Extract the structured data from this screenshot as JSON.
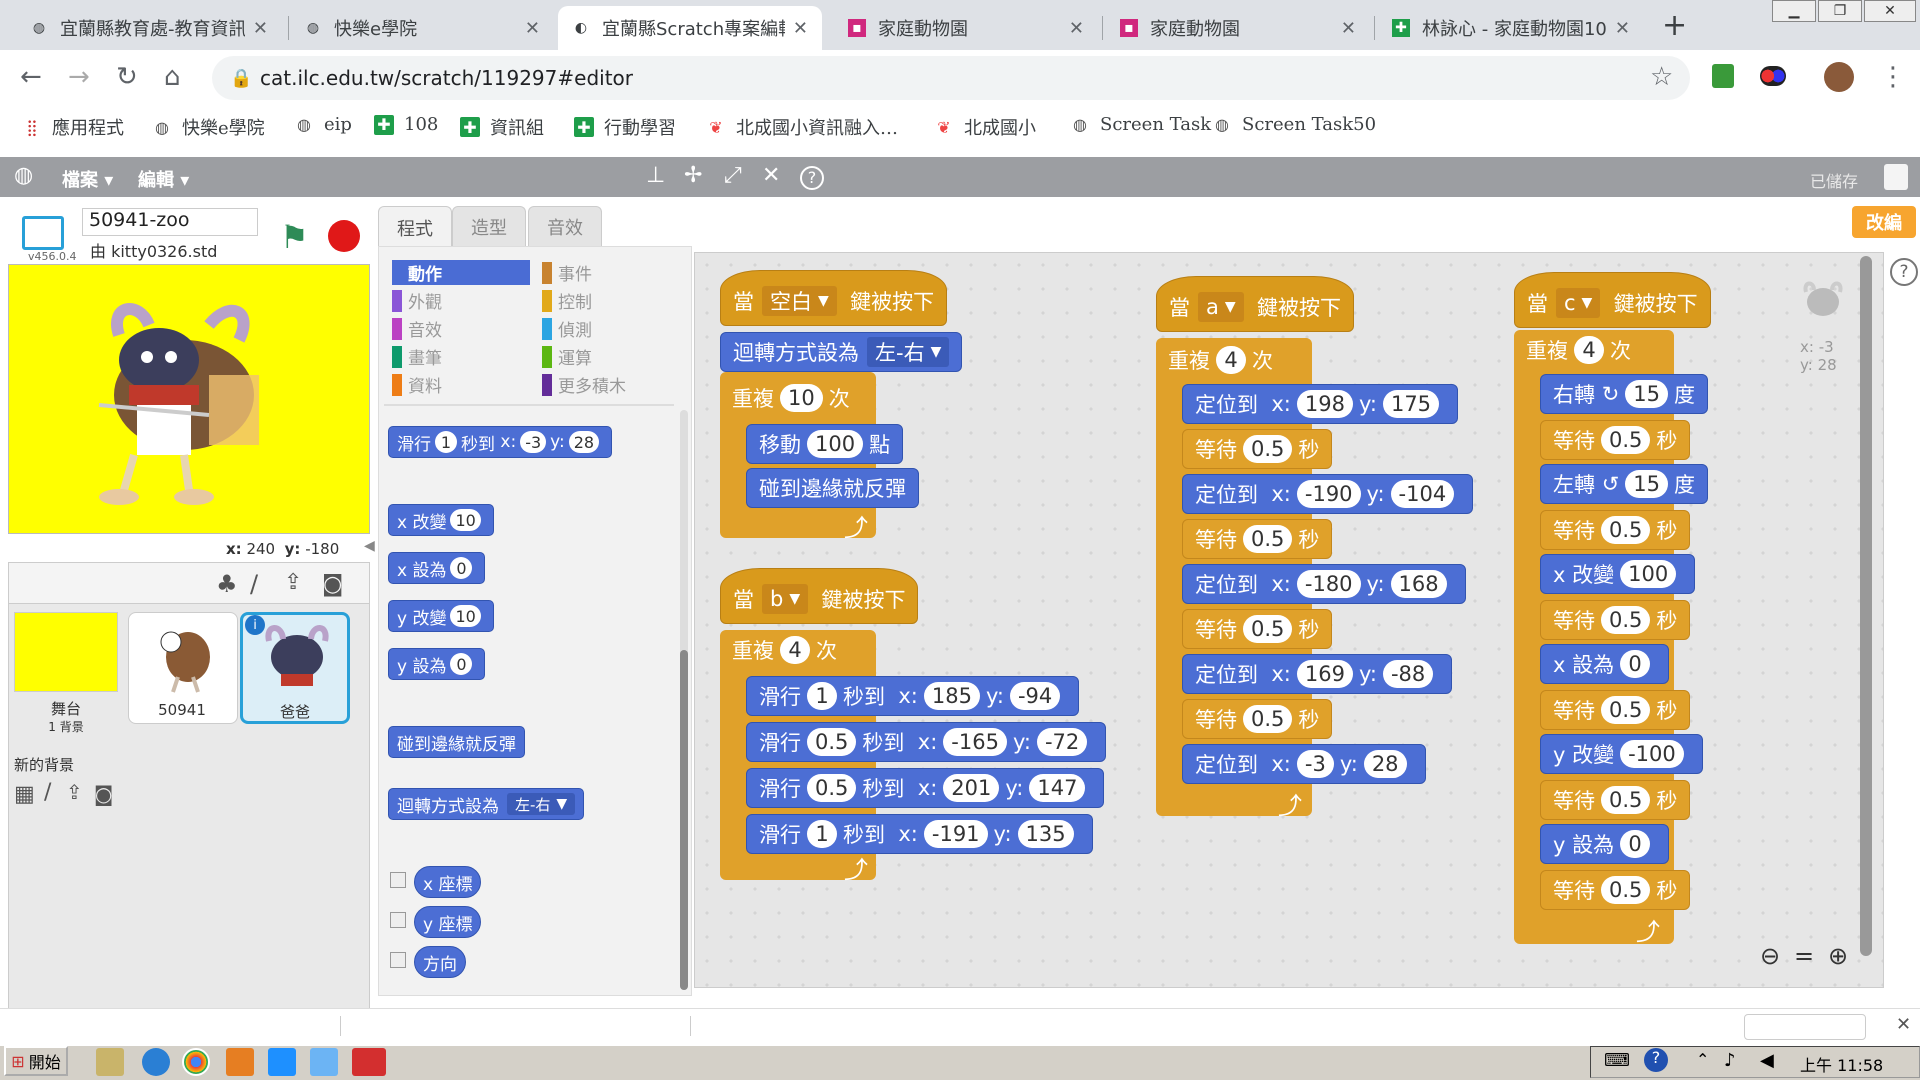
{
  "browser": {
    "tabs": [
      {
        "title": "宜蘭縣教育處-教育資訊",
        "active": false
      },
      {
        "title": "快樂e學院",
        "active": false
      },
      {
        "title": "宜蘭縣Scratch專案編輯",
        "active": true
      },
      {
        "title": "家庭動物園",
        "active": false
      },
      {
        "title": "家庭動物園",
        "active": false
      },
      {
        "title": "林詠心 - 家庭動物園10",
        "active": false
      }
    ],
    "url": "cat.ilc.edu.tw/scratch/119297#editor",
    "bookmarks": [
      "應用程式",
      "快樂e學院",
      "eip",
      "108",
      "資訊組",
      "行動學習",
      "北成國小資訊融入…",
      "北成國小",
      "Screen Task",
      "Screen Task50"
    ]
  },
  "scratch": {
    "menu": {
      "file": "檔案",
      "edit": "編輯",
      "saved": "已儲存",
      "edit_button": "改編"
    },
    "project": {
      "name": "50941-zoo",
      "author": "由 kitty0326.std",
      "version": "v456.0.4"
    },
    "stage_coords": {
      "x_label": "x:",
      "x": "240",
      "y_label": "y:",
      "y": "-180"
    },
    "stage_card": {
      "label": "舞台",
      "sub": "1 背景",
      "new_bg": "新的背景"
    },
    "sprites": [
      {
        "name": "50941",
        "selected": false
      },
      {
        "name": "爸爸",
        "selected": true
      }
    ],
    "tabs": [
      "程式",
      "造型",
      "音效"
    ],
    "categories": {
      "left": [
        {
          "label": "動作",
          "color": "#4a6cd4",
          "active": true
        },
        {
          "label": "外觀",
          "color": "#8a55d7"
        },
        {
          "label": "音效",
          "color": "#bb42c3"
        },
        {
          "label": "畫筆",
          "color": "#0e9a6c"
        },
        {
          "label": "資料",
          "color": "#ee7d16"
        }
      ],
      "right": [
        {
          "label": "事件",
          "color": "#c88330"
        },
        {
          "label": "控制",
          "color": "#e1a91a"
        },
        {
          "label": "偵測",
          "color": "#2ca5e2"
        },
        {
          "label": "運算",
          "color": "#5cb712"
        },
        {
          "label": "更多積木",
          "color": "#632d99"
        }
      ]
    },
    "palette": {
      "glide": {
        "a": "滑行",
        "secs": "1",
        "b": "秒到",
        "xl": "x:",
        "x": "-3",
        "yl": "y:",
        "y": "28"
      },
      "change_x": {
        "a": "x 改變",
        "v": "10"
      },
      "set_x": {
        "a": "x 設為",
        "v": "0"
      },
      "change_y": {
        "a": "y 改變",
        "v": "10"
      },
      "set_y": {
        "a": "y 設為",
        "v": "0"
      },
      "bounce": "碰到邊緣就反彈",
      "rotation": {
        "a": "迴轉方式設為",
        "v": "左-右"
      },
      "reporters": [
        "x 座標",
        "y 座標",
        "方向"
      ]
    },
    "scripts": {
      "s1": {
        "hat": {
          "a": "當",
          "key": "空白",
          "b": "鍵被按下"
        },
        "rot": {
          "a": "迴轉方式設為",
          "v": "左-右"
        },
        "rep": {
          "a": "重複",
          "n": "10",
          "b": "次"
        },
        "move": {
          "a": "移動",
          "v": "100",
          "b": "點"
        },
        "bounce": "碰到邊緣就反彈"
      },
      "s2": {
        "hat": {
          "a": "當",
          "key": "b",
          "b": "鍵被按下"
        },
        "rep": {
          "a": "重複",
          "n": "4",
          "b": "次"
        },
        "glides": [
          {
            "t": "1",
            "x": "185",
            "y": "-94"
          },
          {
            "t": "0.5",
            "x": "-165",
            "y": "-72"
          },
          {
            "t": "0.5",
            "x": "201",
            "y": "147"
          },
          {
            "t": "1",
            "x": "-191",
            "y": "135"
          }
        ],
        "g_a": "滑行",
        "g_b": "秒到",
        "xl": "x:",
        "yl": "y:"
      },
      "s3": {
        "hat": {
          "a": "當",
          "key": "a",
          "b": "鍵被按下"
        },
        "rep": {
          "a": "重複",
          "n": "4",
          "b": "次"
        },
        "go_label": "定位到",
        "wait_a": "等待",
        "wait_b": "秒",
        "xl": "x:",
        "yl": "y:",
        "steps": [
          {
            "x": "198",
            "y": "175",
            "w": "0.5"
          },
          {
            "x": "-190",
            "y": "-104",
            "w": "0.5"
          },
          {
            "x": "-180",
            "y": "168",
            "w": "0.5"
          },
          {
            "x": "169",
            "y": "-88",
            "w": "0.5"
          }
        ],
        "last": {
          "x": "-3",
          "y": "28"
        }
      },
      "s4": {
        "hat": {
          "a": "當",
          "key": "c",
          "b": "鍵被按下"
        },
        "rep": {
          "a": "重複",
          "n": "4",
          "b": "次"
        },
        "turn_r": {
          "a": "右轉",
          "v": "15",
          "b": "度"
        },
        "turn_l": {
          "a": "左轉",
          "v": "15",
          "b": "度"
        },
        "wait_a": "等待",
        "wait_v": "0.5",
        "wait_b": "秒",
        "chx": {
          "a": "x 改變",
          "v": "100"
        },
        "setx": {
          "a": "x 設為",
          "v": "0"
        },
        "chy": {
          "a": "y 改變",
          "v": "-100"
        },
        "sety": {
          "a": "y 設為",
          "v": "0"
        }
      }
    },
    "sprite_xy": {
      "x": "x: -3",
      "y": "y: 28"
    }
  },
  "taskbar": {
    "start": "開始",
    "clock": "上午 11:58"
  }
}
